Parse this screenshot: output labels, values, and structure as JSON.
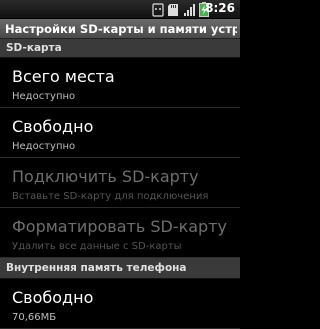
{
  "status_bar": {
    "time": "8:26",
    "icons": [
      "usb-debug-icon",
      "sd-card-icon",
      "signal-icon",
      "battery-charging-icon"
    ]
  },
  "title_bar": {
    "title": "Настройки SD-карты и памяти устройс..."
  },
  "sd_card_section": {
    "header": "SD-карта",
    "items": [
      {
        "title": "Всего места",
        "summary": "Недоступно",
        "enabled": false
      },
      {
        "title": "Свободно",
        "summary": "Недоступно",
        "enabled": false
      },
      {
        "title": "Подключить SD-карту",
        "summary": "Вставьте SD-карту для подключения",
        "enabled": false
      },
      {
        "title": "Форматировать SD-карту",
        "summary": "Удалить все данные с SD-карты",
        "enabled": false
      }
    ]
  },
  "internal_section": {
    "header": "Внутренняя память телефона",
    "items": [
      {
        "title": "Свободно",
        "summary": "70,66МБ",
        "enabled": false
      }
    ]
  },
  "colors": {
    "background": "#000000",
    "title_bar": "#5a5a5a",
    "section_header": "#3a3a3a",
    "disabled_text": "#6e6e6e",
    "battery_green": "#4caf50"
  }
}
